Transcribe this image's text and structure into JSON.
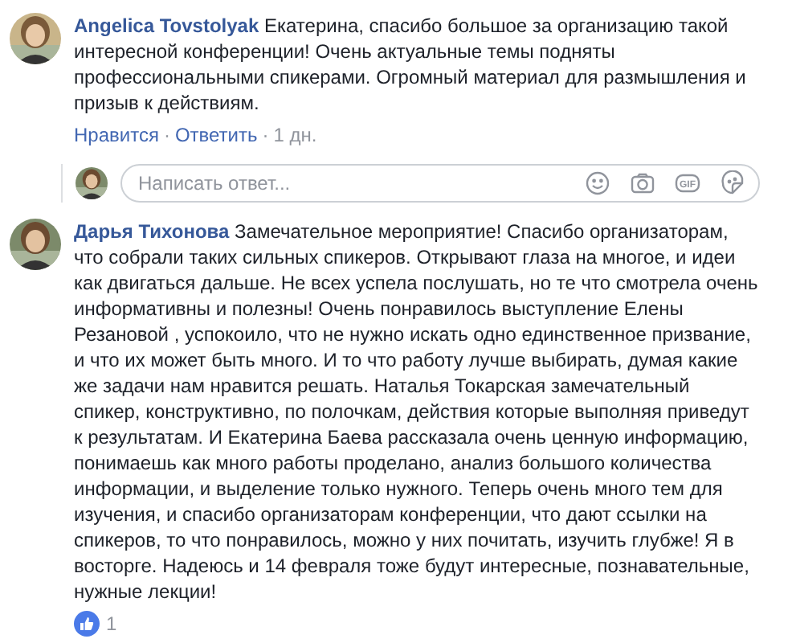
{
  "comments": [
    {
      "author": "Angelica Tovstolyak",
      "text": "Екатерина, спасибо большое за организацию такой интересной конференции! Очень актуальные темы подняты профессиональными спикерами. Огромный материал для размышления и призыв к действиям.",
      "actions": [
        {
          "kind": "link",
          "label": "Нравится"
        },
        {
          "kind": "link",
          "label": "Ответить"
        },
        {
          "kind": "time",
          "label": "1 дн."
        }
      ],
      "separator": "·",
      "reply_box": {
        "placeholder": "Написать ответ...",
        "gif_label": "GIF"
      }
    },
    {
      "author": "Дарья Тихонова",
      "text": "Замечательное мероприятие! Спасибо организаторам, что собрали таких сильных спикеров. Открывают глаза на многое, и идеи как двигаться дальше. Не всех успела послушать, но те что смотрела очень информативны и полезны! Очень понравилось выступление Елены Резановой , успокоило, что не нужно искать одно единственное призвание, и что их может быть много. И то что работу лучше выбирать, думая какие же задачи нам нравится решать. Наталья Токарская замечательный спикер, конструктивно, по полочкам, действия которые выполняя приведут к результатам. И Екатерина Баева рассказала очень ценную информацию, понимаешь как много работы проделано, анализ большого количества информации, и выделение только нужного. Теперь очень много тем для изучения, и спасибо организаторам конференции, что дают ссылки на спикеров, то что понравилось, можно у них почитать, изучить глубже! Я в восторге. Надеюсь и 14 февраля тоже будут интересные, познавательные, нужные лекции!",
      "reactions": {
        "count": "1"
      }
    }
  ]
}
